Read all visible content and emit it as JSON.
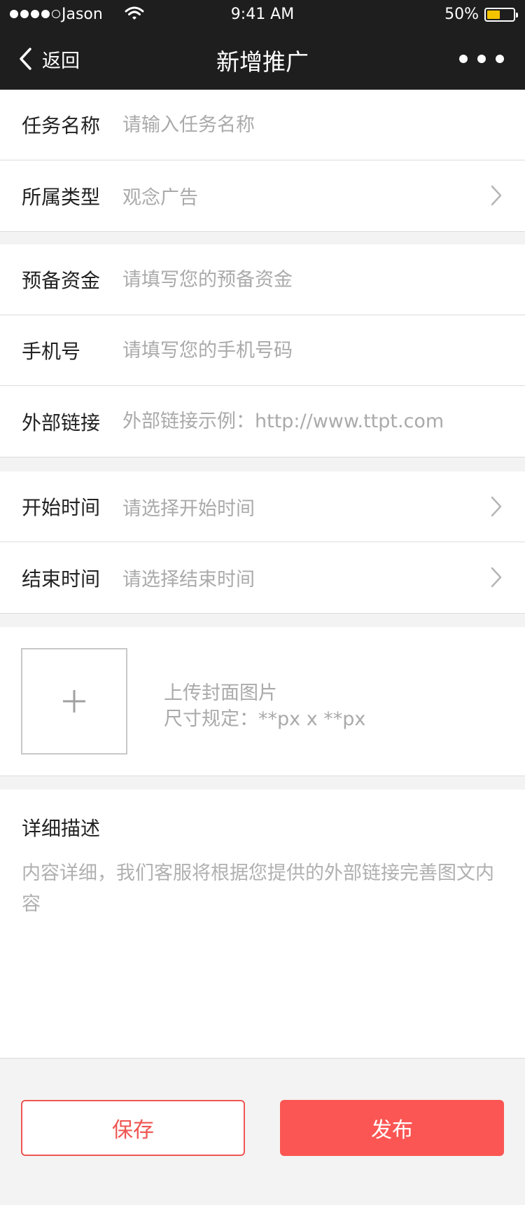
{
  "status_bar": {
    "carrier": "Jason",
    "time": "9:41 AM",
    "battery_text": "50%",
    "battery_level": 0.5,
    "battery_color": "#f5c400"
  },
  "nav": {
    "back_label": "返回",
    "title": "新增推广",
    "back_icon": "chevron-left-icon",
    "more_icon": "more-dots-icon"
  },
  "form": {
    "task_name": {
      "label": "任务名称",
      "placeholder": "请输入任务名称",
      "value": ""
    },
    "category": {
      "label": "所属类型",
      "value": "观念广告"
    },
    "reserve_fund": {
      "label": "预备资金",
      "placeholder": "请填写您的预备资金",
      "value": ""
    },
    "phone": {
      "label": "手机号",
      "placeholder": "请填写您的手机号码",
      "value": ""
    },
    "external_link": {
      "label": "外部链接",
      "placeholder": "外部链接示例：http://www.ttpt.com",
      "value": ""
    },
    "start_time": {
      "label": "开始时间",
      "value": "请选择开始时间"
    },
    "end_time": {
      "label": "结束时间",
      "value": "请选择结束时间"
    }
  },
  "upload": {
    "line1": "上传封面图片",
    "line2": "尺寸规定：**px x **px",
    "icon": "plus-icon"
  },
  "description": {
    "title": "详细描述",
    "placeholder": "内容详细，我们客服将根据您提供的外部链接完善图文内容"
  },
  "actions": {
    "save_label": "保存",
    "publish_label": "发布"
  },
  "colors": {
    "nav_bg": "#1e1e1e",
    "accent": "#fb5653",
    "placeholder": "#aaaaaa",
    "page_bg": "#f3f3f3"
  }
}
